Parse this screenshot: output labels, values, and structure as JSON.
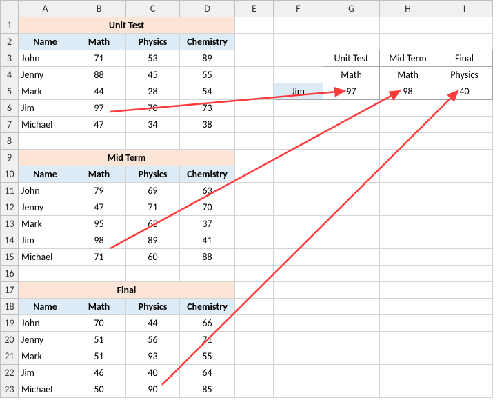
{
  "columns": [
    "A",
    "B",
    "C",
    "D",
    "E",
    "F",
    "G",
    "H",
    "I"
  ],
  "rows": [
    "1",
    "2",
    "3",
    "4",
    "5",
    "6",
    "7",
    "8",
    "9",
    "10",
    "11",
    "12",
    "13",
    "14",
    "15",
    "16",
    "17",
    "18",
    "19",
    "20",
    "21",
    "22",
    "23"
  ],
  "tables": {
    "unit_test": {
      "title": "Unit Test",
      "headers": {
        "name": "Name",
        "math": "Math",
        "physics": "Physics",
        "chemistry": "Chemistry"
      },
      "rows": [
        {
          "name": "John",
          "math": "71",
          "physics": "53",
          "chemistry": "89"
        },
        {
          "name": "Jenny",
          "math": "88",
          "physics": "45",
          "chemistry": "55"
        },
        {
          "name": "Mark",
          "math": "44",
          "physics": "28",
          "chemistry": "54"
        },
        {
          "name": "Jim",
          "math": "97",
          "physics": "70",
          "chemistry": "73"
        },
        {
          "name": "Michael",
          "math": "47",
          "physics": "34",
          "chemistry": "38"
        }
      ]
    },
    "mid_term": {
      "title": "Mid Term",
      "headers": {
        "name": "Name",
        "math": "Math",
        "physics": "Physics",
        "chemistry": "Chemistry"
      },
      "rows": [
        {
          "name": "John",
          "math": "79",
          "physics": "69",
          "chemistry": "63"
        },
        {
          "name": "Jenny",
          "math": "47",
          "physics": "71",
          "chemistry": "70"
        },
        {
          "name": "Mark",
          "math": "95",
          "physics": "63",
          "chemistry": "37"
        },
        {
          "name": "Jim",
          "math": "98",
          "physics": "89",
          "chemistry": "41"
        },
        {
          "name": "Michael",
          "math": "71",
          "physics": "60",
          "chemistry": "88"
        }
      ]
    },
    "final": {
      "title": "Final",
      "headers": {
        "name": "Name",
        "math": "Math",
        "physics": "Physics",
        "chemistry": "Chemistry"
      },
      "rows": [
        {
          "name": "John",
          "math": "70",
          "physics": "44",
          "chemistry": "66"
        },
        {
          "name": "Jenny",
          "math": "51",
          "physics": "56",
          "chemistry": "71"
        },
        {
          "name": "Mark",
          "math": "51",
          "physics": "93",
          "chemistry": "55"
        },
        {
          "name": "Jim",
          "math": "46",
          "physics": "40",
          "chemistry": "64"
        },
        {
          "name": "Michael",
          "math": "50",
          "physics": "90",
          "chemistry": "85"
        }
      ]
    }
  },
  "lookup": {
    "titles": {
      "g": "Unit Test",
      "h": "Mid Term",
      "i": "Final"
    },
    "subjects": {
      "g": "Math",
      "h": "Math",
      "i": "Physics"
    },
    "name": "Jim",
    "values": {
      "g": "97",
      "h": "98",
      "i": "40"
    }
  }
}
